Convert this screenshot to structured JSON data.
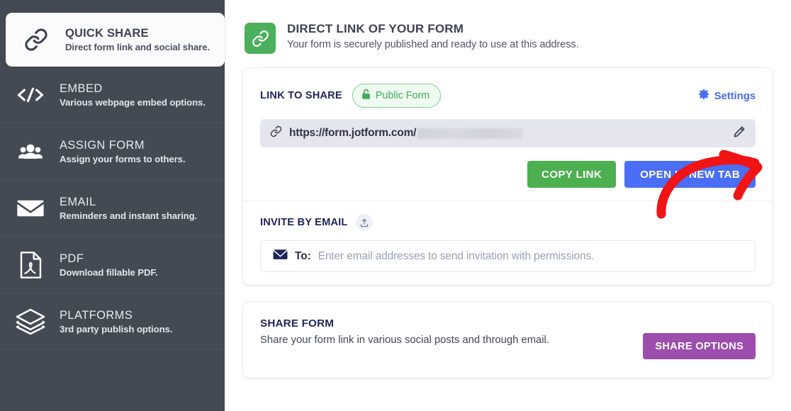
{
  "sidebar": {
    "items": [
      {
        "icon": "link-chain-icon",
        "title": "QUICK SHARE",
        "subtitle": "Direct form link and social share.",
        "active": true
      },
      {
        "icon": "code-brackets-icon",
        "title": "EMBED",
        "subtitle": "Various webpage embed options.",
        "active": false
      },
      {
        "icon": "people-group-icon",
        "title": "ASSIGN FORM",
        "subtitle": "Assign your forms to others.",
        "active": false
      },
      {
        "icon": "envelope-icon",
        "title": "EMAIL",
        "subtitle": "Reminders and instant sharing.",
        "active": false
      },
      {
        "icon": "pdf-document-icon",
        "title": "PDF",
        "subtitle": "Download fillable PDF.",
        "active": false
      },
      {
        "icon": "layers-stack-icon",
        "title": "PLATFORMS",
        "subtitle": "3rd party publish options.",
        "active": false
      }
    ]
  },
  "header": {
    "badge_icon": "link-chain-icon",
    "title": "DIRECT LINK OF YOUR FORM",
    "subtitle": "Your form is securely published and ready to use at this address."
  },
  "link_card": {
    "label": "LINK TO SHARE",
    "visibility_badge": {
      "icon": "open-padlock-icon",
      "label": "Public Form"
    },
    "settings": {
      "icon": "gear-icon",
      "label": "Settings"
    },
    "url": {
      "icon": "link-chain-icon",
      "value": "https://form.jotform.com/",
      "redacted": true,
      "edit_icon": "pencil-icon"
    },
    "copy_button": "COPY LINK",
    "open_button": "OPEN IN NEW TAB",
    "invite": {
      "label": "INVITE BY EMAIL",
      "upload_icon": "upload-icon",
      "to_icon": "envelope-icon",
      "to_label": "To:",
      "placeholder": "Enter email addresses to send invitation with permissions."
    }
  },
  "share_card": {
    "title": "SHARE FORM",
    "description": "Share your form link in various social posts and through email.",
    "button": "SHARE OPTIONS"
  },
  "annotation": {
    "type": "curved-arrow",
    "color": "#f01414",
    "points_at": "COPY LINK"
  },
  "colors": {
    "sidebar_bg": "#434a54",
    "green": "#4caf50",
    "blue": "#4a6ef5",
    "purple": "#9c4dad",
    "navy_text": "#20255c",
    "arrow_red": "#f01414"
  }
}
